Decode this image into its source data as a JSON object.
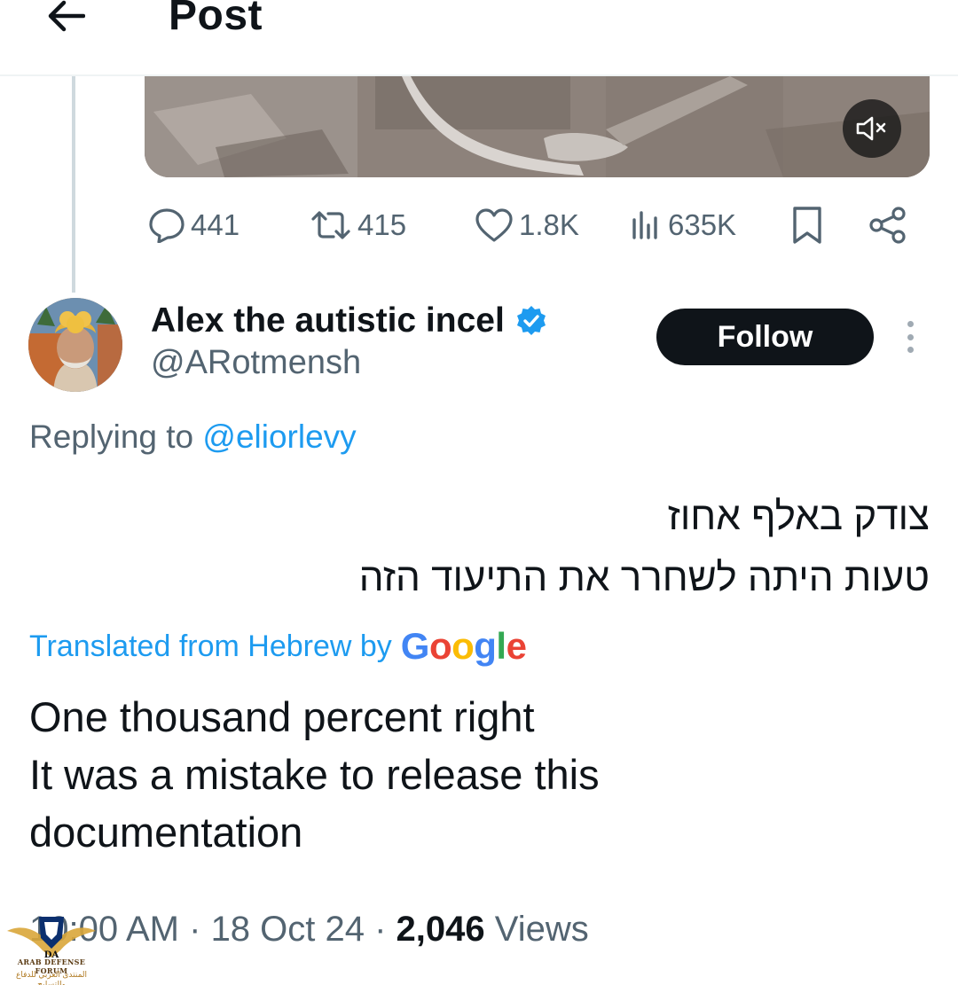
{
  "header": {
    "title": "Post",
    "back_icon": "arrow-left-icon"
  },
  "media": {
    "kind": "video",
    "mute_icon": "speaker-muted-icon"
  },
  "actions": {
    "replies": "441",
    "reposts": "415",
    "likes": "1.8K",
    "views": "635K",
    "bookmark_icon": "bookmark-icon",
    "share_icon": "share-icon"
  },
  "reply": {
    "display_name": "Alex the autistic incel",
    "verified": true,
    "handle": "@ARotmensh",
    "follow_label": "Follow",
    "replying_prefix": "Replying to ",
    "replying_to": "@eliorlevy",
    "original_lines": [
      "צודק באלף אחוז",
      "טעות היתה לשחרר את התיעוד הזה"
    ],
    "translated_prefix": "Translated from Hebrew by",
    "translation_brand": "Google",
    "translation_lines": [
      "One thousand percent right",
      "It was a mistake to release this",
      "documentation"
    ],
    "time": "10:00 AM",
    "date": "18 Oct 24",
    "views_count": "2,046",
    "views_label": "Views"
  },
  "watermark": {
    "line1": "ARAB DEFENSE FORUM",
    "line2": "المنتدى العربي للدفاع والتسليح"
  },
  "colors": {
    "accent": "#1d9bf0",
    "text_primary": "#0f1419",
    "text_secondary": "#536471",
    "follow_bg": "#0f1419",
    "google_blue": "#4285F4",
    "google_red": "#EA4335",
    "google_yellow": "#FBBC05",
    "google_green": "#34A853"
  }
}
